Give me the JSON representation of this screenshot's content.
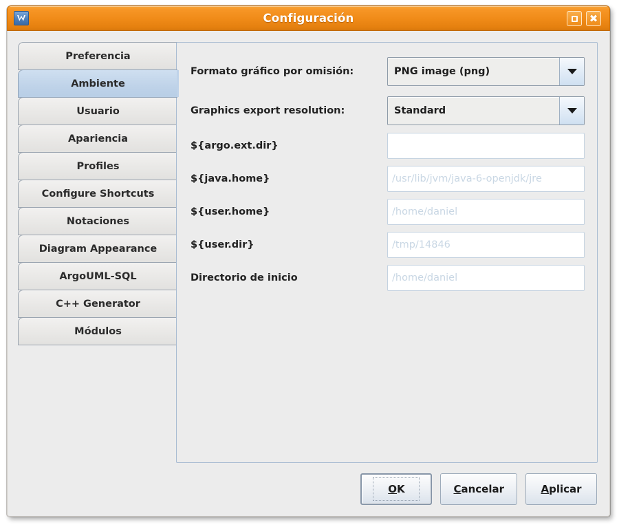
{
  "window": {
    "title": "Configuración",
    "icon": "argouml-app-icon",
    "controls": [
      {
        "name": "maximize",
        "glyph": "square"
      },
      {
        "name": "close",
        "glyph": "✖"
      }
    ]
  },
  "tabs": {
    "selected": "Ambiente",
    "items": [
      {
        "label": "Preferencia",
        "selected": false
      },
      {
        "label": "Ambiente",
        "selected": true
      },
      {
        "label": "Usuario",
        "selected": false
      },
      {
        "label": "Apariencia",
        "selected": false
      },
      {
        "label": "Profiles",
        "selected": false
      },
      {
        "label": "Configure Shortcuts",
        "selected": false
      },
      {
        "label": "Notaciones",
        "selected": false
      },
      {
        "label": "Diagram Appearance",
        "selected": false
      },
      {
        "label": "ArgoUML-SQL",
        "selected": false
      },
      {
        "label": "C++ Generator",
        "selected": false
      },
      {
        "label": "Módulos",
        "selected": false
      }
    ]
  },
  "form": {
    "rows": [
      {
        "label": "Formato gráfico por omisión:",
        "control": "combobox",
        "value": "PNG image (png)"
      },
      {
        "label": "Graphics export resolution:",
        "control": "combobox",
        "value": "Standard"
      },
      {
        "label": "${argo.ext.dir}",
        "control": "textfield",
        "value": ""
      },
      {
        "label": "${java.home}",
        "control": "textfield",
        "value": "/usr/lib/jvm/java-6-openjdk/jre"
      },
      {
        "label": "${user.home}",
        "control": "textfield",
        "value": "/home/daniel"
      },
      {
        "label": "${user.dir}",
        "control": "textfield",
        "value": "/tmp/14846"
      },
      {
        "label": "Directorio de inicio",
        "control": "textfield",
        "value": "/home/daniel"
      }
    ]
  },
  "buttons": {
    "ok": {
      "mnemonic": "O",
      "rest": "K",
      "focused": true
    },
    "cancel": {
      "mnemonic": "C",
      "rest": "ancelar",
      "focused": false
    },
    "apply": {
      "mnemonic": "A",
      "rest": "plicar",
      "focused": false
    }
  },
  "colors": {
    "titlebar_orange": "#f08b18",
    "tab_selected_blue": "#bfd3e9",
    "dialog_background": "#ececec",
    "panel_border": "#a9bcd2",
    "placeholder_text": "#c9d7e4"
  }
}
